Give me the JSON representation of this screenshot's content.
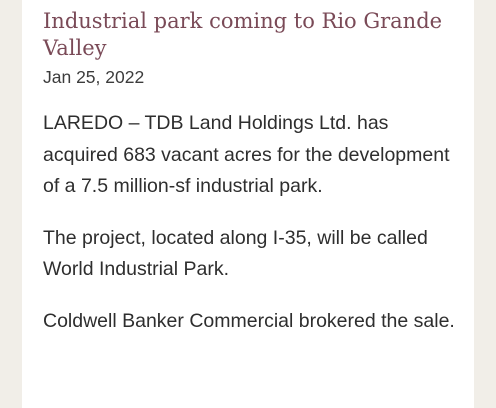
{
  "article": {
    "title": "Industrial park coming to Rio Grande Valley",
    "date": "Jan 25, 2022",
    "paragraphs": [
      "LAREDO – TDB Land Holdings Ltd. has acquired 683 vacant acres for the development of a 7.5 million-sf industrial park.",
      "The project, located along I-35, will be called World Industrial Park.",
      "Coldwell Banker Commercial brokered the sale."
    ]
  },
  "colors": {
    "page_background": "#f1eee8",
    "card_background": "#ffffff",
    "title": "#7a4a57",
    "body_text": "#2e2e2e"
  }
}
